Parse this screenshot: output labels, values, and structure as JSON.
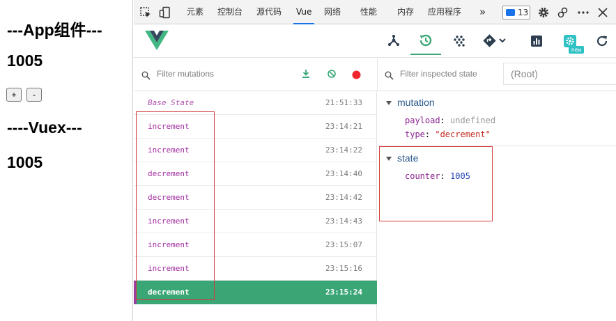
{
  "app": {
    "app_title": "---App组件---",
    "app_count": "1005",
    "plus_label": "+",
    "minus_label": "-",
    "vuex_title": "----Vuex---",
    "vuex_count": "1005"
  },
  "devtools_tabs": {
    "items": [
      "元素",
      "控制台",
      "源代码",
      "Vue",
      "网络",
      "性能",
      "内存",
      "应用程序"
    ],
    "active": "Vue",
    "more": "»",
    "issues_count": "13",
    "icons": [
      "inspect-element-icon",
      "device-toggle-icon",
      "settings-gear-icon",
      "remote-devices-icon",
      "more-options-icon"
    ]
  },
  "vue_toolbar": {
    "logo": "vue-logo",
    "icons": [
      "components-tree-icon",
      "vuex-history-icon",
      "events-icon",
      "routing-icon",
      "performance-icon",
      "settings-icon",
      "refresh-icon"
    ],
    "new_badge": "new",
    "accent": "#3ba776"
  },
  "filters": {
    "mutations_placeholder": "Filter mutations",
    "inspected_placeholder": "Filter inspected state",
    "root_select": "(Root)"
  },
  "mutations": [
    {
      "name": "Base State",
      "time": "21:51:33"
    },
    {
      "name": "increment",
      "time": "23:14:21"
    },
    {
      "name": "increment",
      "time": "23:14:22"
    },
    {
      "name": "decrement",
      "time": "23:14:40"
    },
    {
      "name": "decrement",
      "time": "23:14:42"
    },
    {
      "name": "increment",
      "time": "23:14:43"
    },
    {
      "name": "increment",
      "time": "23:15:07"
    },
    {
      "name": "increment",
      "time": "23:15:16"
    },
    {
      "name": "decrement",
      "time": "23:15:24"
    }
  ],
  "selected_mutation_color": "#3aa675",
  "inspector": {
    "mutation_label": "mutation",
    "payload_key": "payload",
    "payload_value": "undefined",
    "type_key": "type",
    "type_value": "\"decrement\"",
    "state_label": "state",
    "counter_key": "counter",
    "counter_value": "1005"
  }
}
